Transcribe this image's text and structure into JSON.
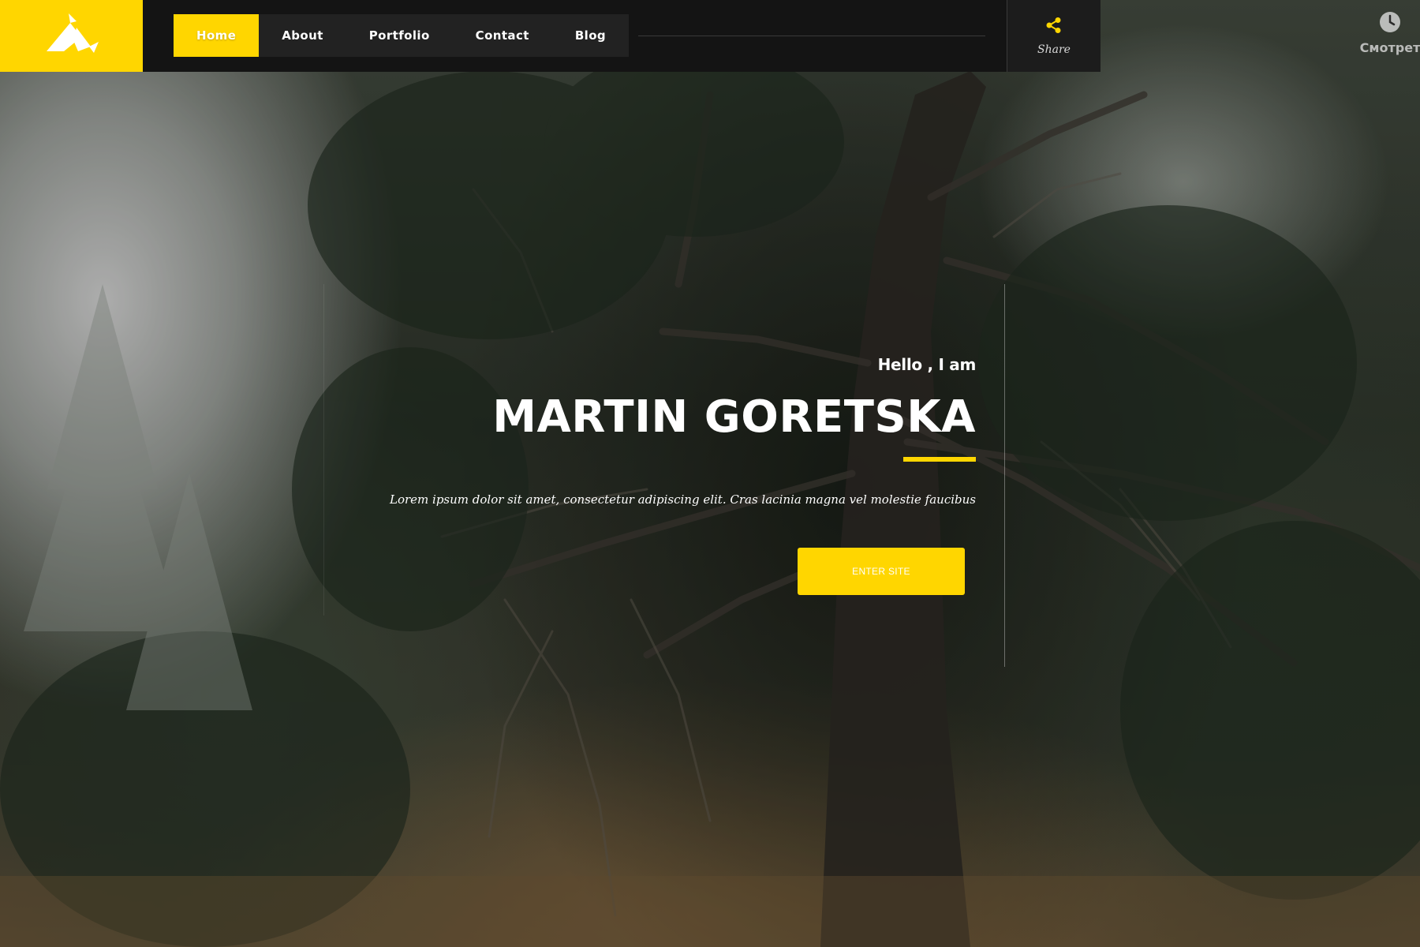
{
  "brand": {
    "accent_color": "#ffd600",
    "logo_icon": "geometric-bird-logo"
  },
  "nav": {
    "items": [
      {
        "label": "Home",
        "active": true
      },
      {
        "label": "About",
        "active": false
      },
      {
        "label": "Portfolio",
        "active": false
      },
      {
        "label": "Contact",
        "active": false
      },
      {
        "label": "Blog",
        "active": false
      }
    ]
  },
  "share": {
    "icon": "share-icon",
    "label": "Share"
  },
  "watch_widget": {
    "icon": "clock-icon",
    "label": "Смотрет"
  },
  "hero": {
    "greeting": "Hello , I am",
    "name": "MARTIN GORETSKA",
    "lead": "Lorem ipsum dolor sit amet, consectetur adipiscing elit. Cras lacinia magna vel molestie faucibus",
    "cta_label": "ENTER SITE"
  }
}
